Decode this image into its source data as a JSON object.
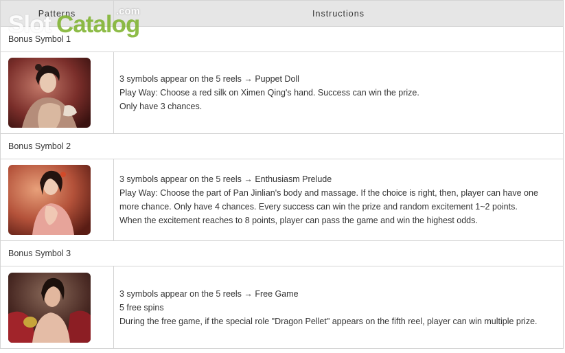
{
  "table": {
    "header_patterns": "Patterns",
    "header_instructions": "Instructions"
  },
  "rows": [
    {
      "label": "Bonus Symbol 1",
      "image_name": "puppet-doll-character-image",
      "lines": [
        "3 symbols appear on the 5 reels → Puppet Doll",
        "Play Way: Choose a red silk on Ximen Qing's hand. Success can win the prize.",
        "Only have 3 chances."
      ]
    },
    {
      "label": "Bonus Symbol 2",
      "image_name": "enthusiasm-prelude-character-image",
      "lines": [
        "3 symbols appear on the 5 reels → Enthusiasm Prelude",
        "Play Way: Choose the part of Pan Jinlian's body and massage. If the choice is right, then, player can have one more chance. Only have 4 chances. Every success can win the prize and random excitement 1~2 points.",
        "When the excitement reaches to 8 points, player can pass the game and win the highest odds."
      ]
    },
    {
      "label": "Bonus Symbol 3",
      "image_name": "free-game-character-image",
      "lines": [
        "3 symbols appear on the 5 reels → Free Game",
        "5 free spins",
        "During the free game, if the special role \"Dragon Pellet\" appears on the fifth reel, player can win multiple prize."
      ]
    }
  ],
  "watermark": {
    "slot": "Slot",
    "catalog": "Catalog",
    "dotcom": ".com"
  },
  "colors": {
    "header_bg": "#e6e6e6",
    "border": "#d4d4d4",
    "text": "#333333",
    "watermark_green": "#7ab028"
  }
}
